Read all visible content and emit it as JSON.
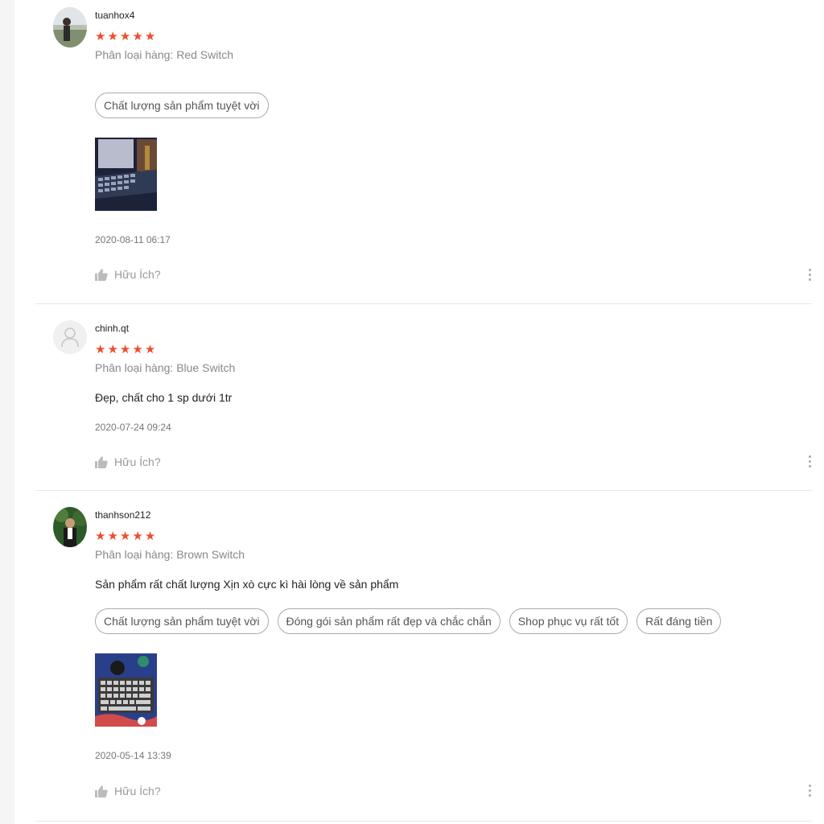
{
  "reviews": [
    {
      "username": "tuanhox4",
      "rating": 5,
      "variant": "Phân loại hàng: Red Switch",
      "comment": "",
      "tags": [
        "Chất lượng sản phẩm tuyệt vời"
      ],
      "has_photo": true,
      "date": "2020-08-11 06:17",
      "helpful_label": "Hữu Ích?"
    },
    {
      "username": "chinh.qt",
      "rating": 5,
      "variant": "Phân loại hàng: Blue Switch",
      "comment": "Đẹp, chất cho 1 sp dưới 1tr",
      "tags": [],
      "has_photo": false,
      "date": "2020-07-24 09:24",
      "helpful_label": "Hữu Ích?"
    },
    {
      "username": "thanhson212",
      "rating": 5,
      "variant": "Phân loại hàng: Brown Switch",
      "comment": "Sản phẩm rất chất lượng Xịn xò cực kì hài lòng về sản phẩm",
      "tags": [
        "Chất lượng sản phẩm tuyệt vời",
        "Đóng gói sản phẩm rất đẹp và chắc chắn",
        "Shop phục vụ rất tốt",
        "Rất đáng tiền"
      ],
      "has_photo": true,
      "date": "2020-05-14 13:39",
      "helpful_label": "Hữu Ích?"
    }
  ],
  "colors": {
    "star": "#ee4d2d",
    "muted": "#888888",
    "divider": "#e8e8e8"
  },
  "icons": {
    "rating": "star-icon",
    "helpful": "thumbs-up-icon",
    "more": "more-vertical-icon",
    "default_avatar": "user-icon"
  }
}
